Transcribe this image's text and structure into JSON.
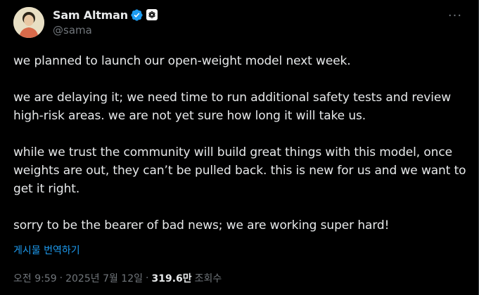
{
  "author": {
    "display_name": "Sam Altman",
    "handle": "@sama",
    "verified_badge": "verified-check-icon",
    "affiliate_badge": "openai-logo-icon",
    "avatar": "avatar"
  },
  "menu": {
    "more_icon": "more-icon",
    "more_label": "···"
  },
  "post": {
    "paragraphs": [
      "we planned to launch our open-weight model next week.",
      "we are delaying it; we need time to run additional safety tests and review high-risk areas. we are not yet sure how long it will take us.",
      "while we trust the community will build great things with this model, once weights are out, they can’t be pulled back. this is new for us and we want to get it right.",
      "sorry to be the bearer of bad news; we are working super hard!"
    ],
    "translate_label": "게시물 번역하기"
  },
  "meta": {
    "time": "오전 9:59",
    "date": "2025년 7월 12일",
    "separator": "·",
    "views_count": "319.6만",
    "views_label": "조회수"
  },
  "colors": {
    "background": "#000000",
    "text": "#e7e9ea",
    "muted": "#71767b",
    "link": "#1d9bf0",
    "verified": "#1d9bf0"
  }
}
